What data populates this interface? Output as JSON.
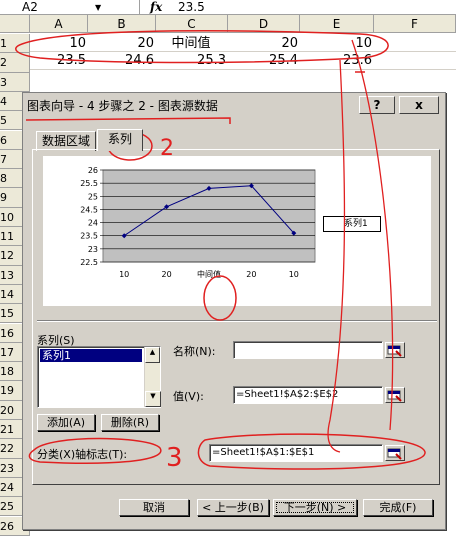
{
  "formula_bar": {
    "name_box": "A2",
    "fx": "fx",
    "value": "23.5"
  },
  "columns": [
    "A",
    "B",
    "C",
    "D",
    "E",
    "F"
  ],
  "rows": [
    "1",
    "2",
    "3",
    "4",
    "5",
    "6",
    "7",
    "8",
    "9",
    "10",
    "11",
    "12",
    "13",
    "14",
    "15",
    "16",
    "17",
    "18",
    "19",
    "20",
    "21",
    "22",
    "23",
    "24",
    "25",
    "26"
  ],
  "row1": [
    "10",
    "20",
    "中间值",
    "20",
    "10"
  ],
  "row2": [
    "23.5",
    "24.6",
    "25.3",
    "25.4",
    "23.6"
  ],
  "dialog": {
    "title": "图表向导 - 4 步骤之 2 - 图表源数据",
    "help_label": "?",
    "close_label": "x",
    "tabs": [
      "数据区域",
      "系列"
    ],
    "series_label": "系列(S)",
    "series_list": [
      "系列1"
    ],
    "add_label": "添加(A)",
    "remove_label": "删除(R)",
    "name_label": "名称(N):",
    "name_value": "",
    "values_label": "值(V):",
    "values_value": "=Sheet1!$A$2:$E$2",
    "category_label": "分类(X)轴标志(T):",
    "category_value": "=Sheet1!$A$1:$E$1",
    "cancel_label": "取消",
    "back_label": "< 上一步(B)",
    "next_label": "下一步(N) >",
    "finish_label": "完成(F)"
  },
  "chart_data": {
    "type": "line",
    "categories": [
      "10",
      "20",
      "中间值",
      "20",
      "10"
    ],
    "series": [
      {
        "name": "系列1",
        "values": [
          23.5,
          24.6,
          25.3,
          25.4,
          23.6
        ]
      }
    ],
    "yticks": [
      "26",
      "25.5",
      "25",
      "24.5",
      "24",
      "23.5",
      "23",
      "22.5"
    ],
    "ylim": [
      22.5,
      26
    ],
    "grid": true,
    "legend": "right",
    "line_color": "#000080"
  },
  "annotations": {
    "mark2": "2",
    "mark3": "3"
  }
}
